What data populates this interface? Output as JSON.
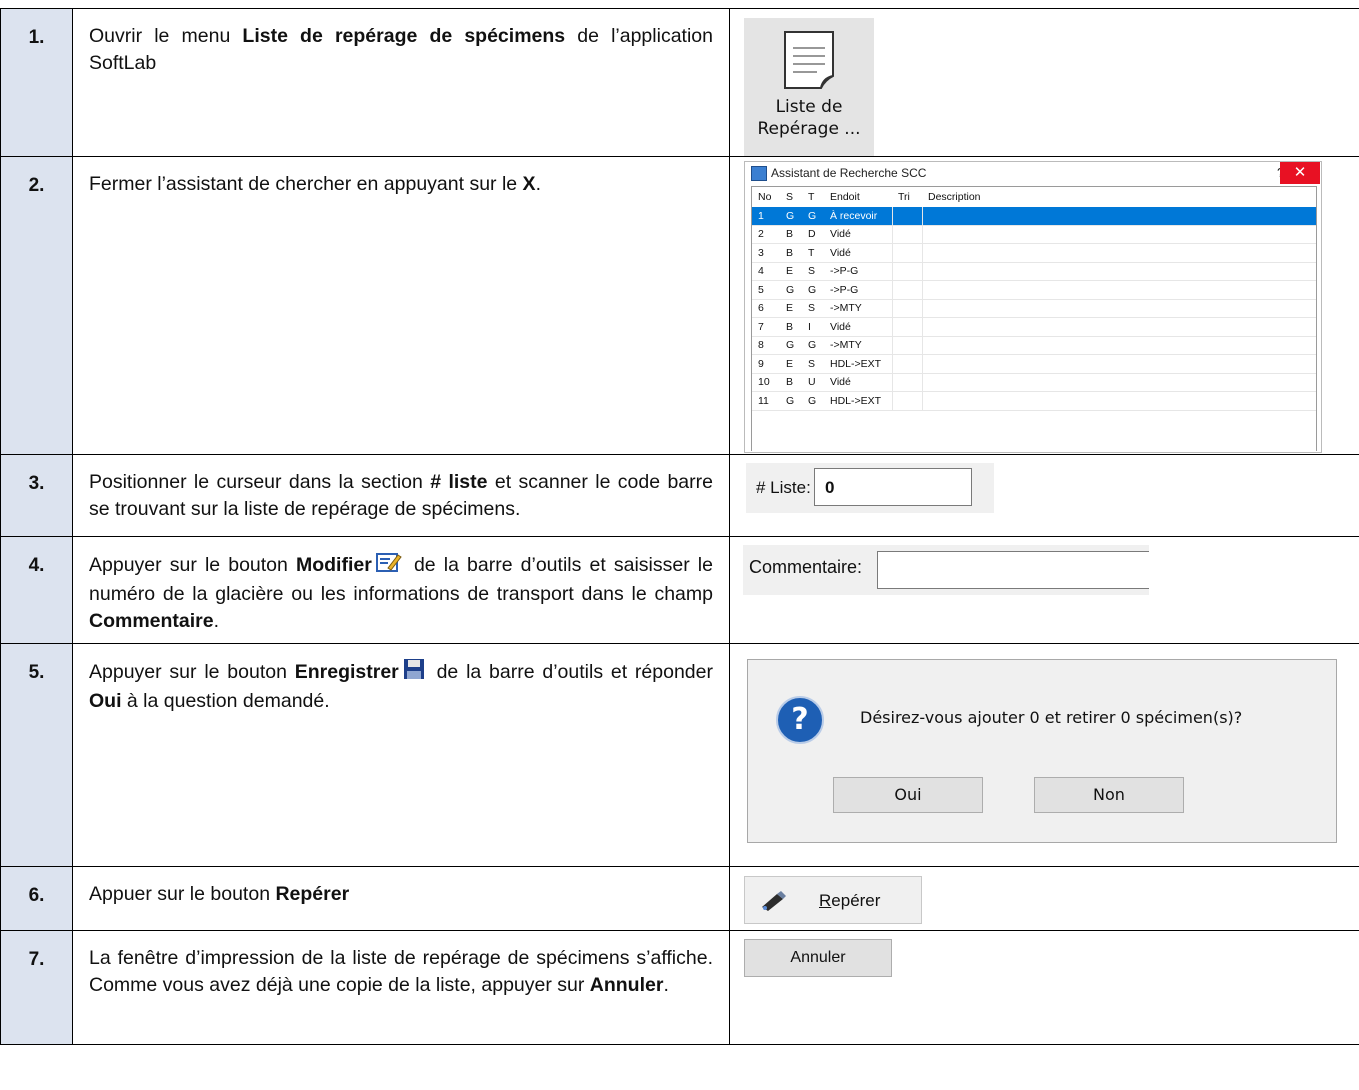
{
  "steps": [
    {
      "num": "1.",
      "parts": [
        {
          "t": "Ouvrir le menu "
        },
        {
          "t": "Liste de repérage de spécimens",
          "b": true
        },
        {
          "t": " de l’application SoftLab"
        }
      ]
    },
    {
      "num": "2.",
      "parts": [
        {
          "t": "Fermer l’assistant de chercher en appuyant sur le "
        },
        {
          "t": "X",
          "b": true
        },
        {
          "t": "."
        }
      ]
    },
    {
      "num": "3.",
      "parts": [
        {
          "t": "Positionner le curseur dans la section  "
        },
        {
          "t": "# liste",
          "b": true
        },
        {
          "t": " et scanner le code barre se trouvant sur la liste de repérage de spécimens."
        }
      ]
    },
    {
      "num": "4.",
      "parts": [
        {
          "t": "Appuyer sur le bouton "
        },
        {
          "t": "Modifier",
          "b": true
        },
        {
          "icon": "edit-icon"
        },
        {
          "t": " de la barre d’outils et saisisser le numéro de la glacière ou les informations de transport dans le champ "
        },
        {
          "t": "Commentaire",
          "b": true
        },
        {
          "t": "."
        }
      ]
    },
    {
      "num": "5.",
      "parts": [
        {
          "t": "Appuyer sur le bouton "
        },
        {
          "t": "Enregistrer",
          "b": true
        },
        {
          "icon": "save-icon"
        },
        {
          "t": " de la barre d’outils et réponder "
        },
        {
          "t": "Oui",
          "b": true
        },
        {
          "t": " à la question demandé."
        }
      ]
    },
    {
      "num": "6.",
      "parts": [
        {
          "t": "Appuer sur le bouton "
        },
        {
          "t": "Repérer",
          "b": true
        }
      ]
    },
    {
      "num": "7.",
      "parts": [
        {
          "t": "La fenêtre d’impression de la liste de repérage de spécimens s’affiche. Comme vous avez déjà une copie de la liste, appuyer sur "
        },
        {
          "t": "Annuler",
          "b": true
        },
        {
          "t": "."
        }
      ]
    }
  ],
  "tile": {
    "label_line1": "Liste de",
    "label_line2": "Repérage ...",
    "icon": "document-icon"
  },
  "assistant": {
    "title": "Assistant de Recherche SCC",
    "help": "?",
    "close": "✕",
    "columns": [
      "No",
      "S",
      "T",
      "Endoit",
      "Tri",
      "Description"
    ],
    "rows": [
      [
        "1",
        "G",
        "G",
        "À recevoir",
        "",
        ""
      ],
      [
        "2",
        "B",
        "D",
        "Vidé",
        "",
        ""
      ],
      [
        "3",
        "B",
        "T",
        "Vidé",
        "",
        ""
      ],
      [
        "4",
        "E",
        "S",
        "->P-G",
        "",
        ""
      ],
      [
        "5",
        "G",
        "G",
        "->P-G",
        "",
        ""
      ],
      [
        "6",
        "E",
        "S",
        "->MTY",
        "",
        ""
      ],
      [
        "7",
        "B",
        "I",
        "Vidé",
        "",
        ""
      ],
      [
        "8",
        "G",
        "G",
        "->MTY",
        "",
        ""
      ],
      [
        "9",
        "E",
        "S",
        "HDL->EXT",
        "",
        ""
      ],
      [
        "10",
        "B",
        "U",
        "Vidé",
        "",
        ""
      ],
      [
        "11",
        "G",
        "G",
        "HDL->EXT",
        "",
        ""
      ]
    ],
    "selected_row": 0,
    "selection_color": "#0078d7"
  },
  "liste_field": {
    "label": "# Liste:",
    "value": "0"
  },
  "comment_field": {
    "label": "Commentaire:",
    "value": ""
  },
  "dialog": {
    "icon": "question-icon",
    "icon_glyph": "?",
    "message": "Désirez-vous ajouter 0 et retirer 0 spécimen(s)?",
    "yes_label": "Oui",
    "no_label": "Non"
  },
  "reperer_button": {
    "label_prefix": "R",
    "label_rest": "epérer",
    "icon": "telescope-icon"
  },
  "annuler_button": {
    "label": "Annuler"
  },
  "colors": {
    "number_column": "#dce3ef",
    "close_red": "#e81123"
  }
}
